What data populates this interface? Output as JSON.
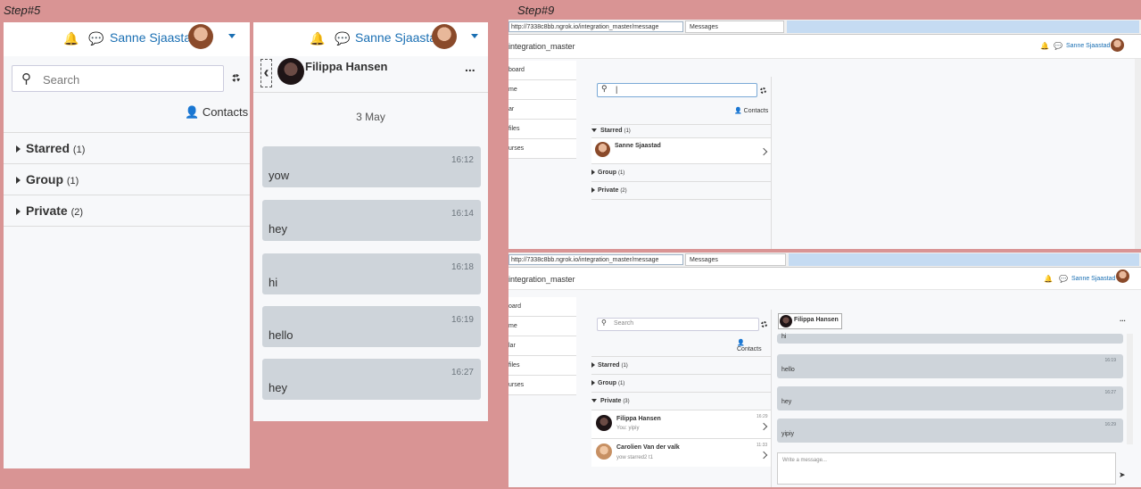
{
  "labels": {
    "step5": "Step#5",
    "step9": "Step#9"
  },
  "user": {
    "name": "Sanne Sjaastad"
  },
  "left_panel": {
    "search_placeholder": "Search",
    "contacts_label": "Contacts",
    "sections": [
      {
        "name": "Starred",
        "count": "(1)"
      },
      {
        "name": "Group",
        "count": "(1)"
      },
      {
        "name": "Private",
        "count": "(2)"
      }
    ]
  },
  "conversation": {
    "contact_name": "Filippa Hansen",
    "more_label": "...",
    "date": "3 May",
    "messages": [
      {
        "time": "16:12",
        "text": "yow"
      },
      {
        "time": "16:14",
        "text": "hey"
      },
      {
        "time": "16:18",
        "text": "hi"
      },
      {
        "time": "16:19",
        "text": "hello"
      },
      {
        "time": "16:27",
        "text": "hey"
      }
    ]
  },
  "browser_top": {
    "url": "http://7338c8bb.ngrok.io/integration_master/message",
    "tab_title": "Messages",
    "page_title": "integration_master",
    "nav": [
      "board",
      "me",
      "ar",
      "files",
      "urses"
    ],
    "search_value": "|",
    "contacts_label": "Contacts",
    "starred_header": {
      "name": "Starred",
      "count": "(1)"
    },
    "starred_contact": "Sanne Sjaastad",
    "group_header": {
      "name": "Group",
      "count": "(1)"
    },
    "private_header": {
      "name": "Private",
      "count": "(2)"
    }
  },
  "browser_bottom": {
    "url": "http://7338c8bb.ngrok.io/integration_master/message",
    "tab_title": "Messages",
    "page_title": "integration_master",
    "nav": [
      "oard",
      "me",
      "lar",
      "files",
      "urses"
    ],
    "search_placeholder": "Search",
    "contacts_label": "Contacts",
    "starred_header": {
      "name": "Starred",
      "count": "(1)"
    },
    "group_header": {
      "name": "Group",
      "count": "(1)"
    },
    "private_header": {
      "name": "Private",
      "count": "(3)"
    },
    "contacts": [
      {
        "name": "Filippa Hansen",
        "preview": "You: yipiy",
        "time": "16:29"
      },
      {
        "name": "Carolien Van der valk",
        "preview": "yow starred2 t1",
        "time": "11:33"
      }
    ],
    "chat_name": "Filippa Hansen",
    "more_label": "...",
    "messages": [
      {
        "text": "hi",
        "time": ""
      },
      {
        "text": "hello",
        "time": "16:19"
      },
      {
        "text": "hey",
        "time": "16:27"
      },
      {
        "text": "yipiy",
        "time": "16:29"
      }
    ],
    "compose_placeholder": "Write a message..."
  }
}
